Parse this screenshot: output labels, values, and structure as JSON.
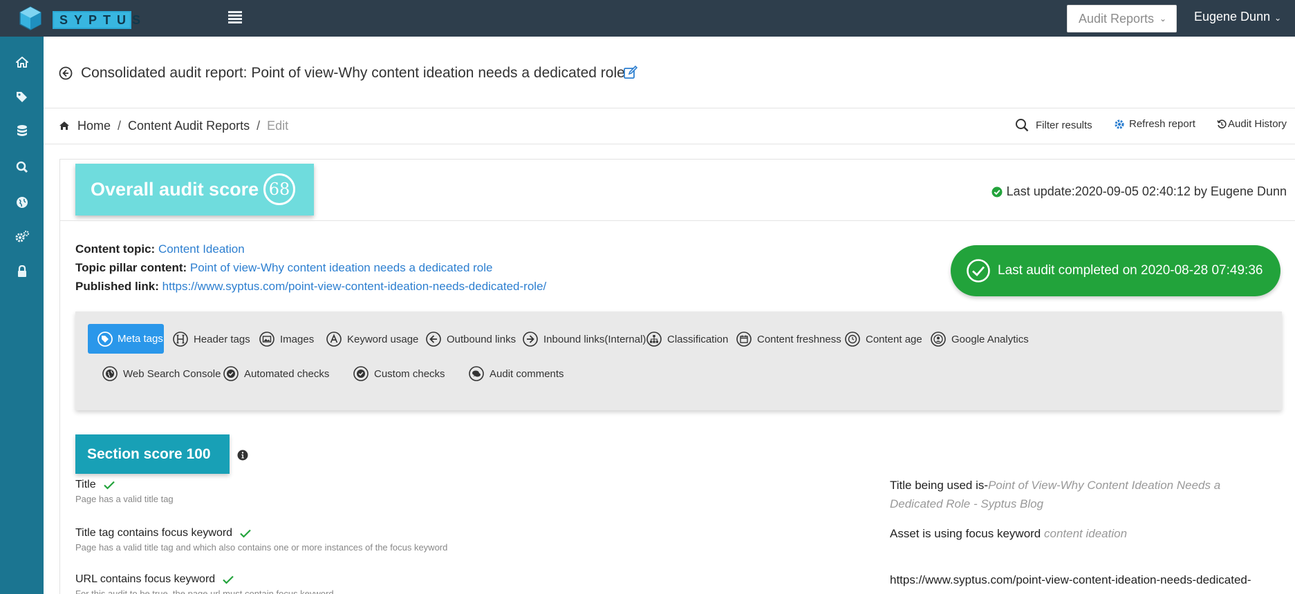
{
  "app": {
    "logo_text": "SYPTUS",
    "reports_menu": "Audit Reports",
    "user_name": "Eugene Dunn"
  },
  "sidebar": {
    "items": [
      {
        "icon": "home-icon"
      },
      {
        "icon": "tags-icon"
      },
      {
        "icon": "database-icon"
      },
      {
        "icon": "search-icon"
      },
      {
        "icon": "globe-icon"
      },
      {
        "icon": "cogs-icon"
      },
      {
        "icon": "lock-icon"
      }
    ]
  },
  "header": {
    "title": "Consolidated audit report: Point of view-Why content ideation needs a dedicated role"
  },
  "breadcrumb": {
    "home": "Home",
    "reports": "Content Audit Reports",
    "current": "Edit",
    "sep": "/"
  },
  "actions": {
    "filter": "Filter results",
    "refresh": "Refresh report",
    "history": "Audit History"
  },
  "card": {
    "score_label": "Overall audit score",
    "score_value": "68",
    "last_update": "Last update:2020-09-05 02:40:12 by Eugene Dunn",
    "content_topic_label": "Content topic:",
    "content_topic": "Content Ideation",
    "pillar_label": "Topic pillar content:",
    "pillar": "Point of view-Why content ideation needs a dedicated role",
    "published_label": "Published link:",
    "published_link": "https://www.syptus.com/point-view-content-ideation-needs-dedicated-role/",
    "last_audit": "Last audit completed on 2020-08-28 07:49:36",
    "status_color": "#22a33b"
  },
  "tabs": [
    {
      "label": "Meta tags",
      "icon": "tags-icon",
      "active": true
    },
    {
      "label": "Header tags",
      "icon": "header-icon"
    },
    {
      "label": "Images",
      "icon": "image-icon"
    },
    {
      "label": "Keyword usage",
      "icon": "font-icon"
    },
    {
      "label": "Outbound links",
      "icon": "arrow-left-icon"
    },
    {
      "label": "Inbound links(Internal)",
      "icon": "arrow-right-icon"
    },
    {
      "label": "Classification",
      "icon": "sitemap-icon"
    },
    {
      "label": "Content freshness",
      "icon": "calendar-icon"
    },
    {
      "label": "Content age",
      "icon": "clock-icon"
    },
    {
      "label": "Google Analytics",
      "icon": "user-circle-icon"
    },
    {
      "label": "Web Search Console",
      "icon": "globe-icon"
    },
    {
      "label": "Automated checks",
      "icon": "check-circle-icon"
    },
    {
      "label": "Custom checks",
      "icon": "check-circle-icon"
    },
    {
      "label": "Audit comments",
      "icon": "comments-icon"
    }
  ],
  "section": {
    "score_label": "Section score 100"
  },
  "checks": [
    {
      "title": "Title",
      "desc": "Page has a valid title tag",
      "result_prefix": "Title being used is-",
      "result_value": "Point of View-Why Content Ideation Needs a Dedicated Role - Syptus Blog"
    },
    {
      "title": "Title tag contains focus keyword",
      "desc": "Page has a valid title tag and which also contains one or more instances of the focus keyword",
      "result_prefix": "Asset is using focus keyword ",
      "result_value": "content ideation"
    },
    {
      "title": "URL contains focus keyword",
      "desc": "For this audit to be true, the page url must contain focus keyword",
      "result_prefix": "https://www.syptus.com/point-view-content-ideation-needs-dedicated-",
      "result_value": ""
    }
  ]
}
